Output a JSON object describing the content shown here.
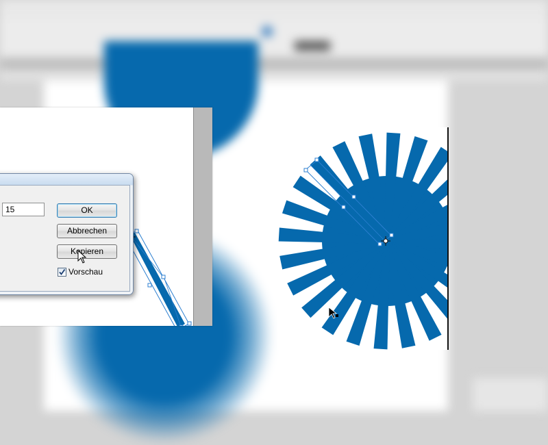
{
  "app": {
    "accent": "#0669ad",
    "canvas_bg": "#ffffff",
    "ui_grey": "#d4d4d4"
  },
  "dialog": {
    "angle_value": "15",
    "ok_label": "OK",
    "cancel_label": "Abbrechen",
    "copy_label": "Kopieren",
    "preview_label": "Vorschau",
    "preview_checked": true
  },
  "shapes": {
    "sunburst_rays": 24,
    "fill_color": "#0669ad",
    "selection_color": "#2c7fd0"
  },
  "icons": {
    "rotate_origin": "crosshair-origin-icon",
    "cursor_dialog": "arrow-cursor-icon",
    "cursor_canvas": "arrow-cursor-icon"
  }
}
